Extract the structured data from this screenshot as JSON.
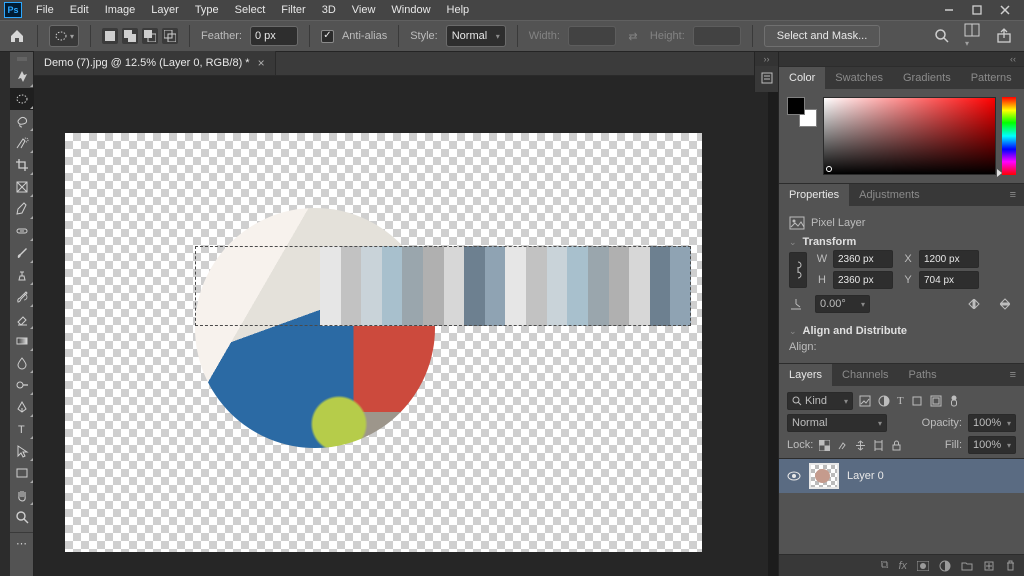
{
  "window_controls": {
    "minimize": "–",
    "maximize": "❐",
    "close": "✕"
  },
  "menu": [
    "File",
    "Edit",
    "Image",
    "Layer",
    "Type",
    "Select",
    "Filter",
    "3D",
    "View",
    "Window",
    "Help"
  ],
  "options": {
    "feather_label": "Feather:",
    "feather_value": "0 px",
    "antialias_label": "Anti-alias",
    "style_label": "Style:",
    "style_value": "Normal",
    "width_label": "Width:",
    "height_label": "Height:",
    "select_mask": "Select and Mask..."
  },
  "doc_tab": "Demo (7).jpg @ 12.5% (Layer 0, RGB/8) *",
  "tools": [
    "move-tool",
    "elliptical-marquee-tool",
    "lasso-tool",
    "quick-selection-tool",
    "crop-tool",
    "frame-tool",
    "eyedropper-tool",
    "healing-brush-tool",
    "brush-tool",
    "clone-stamp-tool",
    "history-brush-tool",
    "eraser-tool",
    "gradient-tool",
    "blur-tool",
    "dodge-tool",
    "pen-tool",
    "type-tool",
    "path-selection-tool",
    "rectangle-tool",
    "hand-tool",
    "zoom-tool"
  ],
  "color": {
    "tabs": [
      "Color",
      "Swatches",
      "Gradients",
      "Patterns"
    ]
  },
  "properties": {
    "tabs": [
      "Properties",
      "Adjustments"
    ],
    "type": "Pixel Layer",
    "transform_label": "Transform",
    "w_label": "W",
    "w_value": "2360 px",
    "h_label": "H",
    "h_value": "2360 px",
    "x_label": "X",
    "x_value": "1200 px",
    "y_label": "Y",
    "y_value": "704 px",
    "angle_value": "0.00°",
    "align_label": "Align and Distribute",
    "align_sub": "Align:"
  },
  "layers": {
    "tabs": [
      "Layers",
      "Channels",
      "Paths"
    ],
    "kind_label": "Kind",
    "blend_mode": "Normal",
    "opacity_label": "Opacity:",
    "opacity_value": "100%",
    "lock_label": "Lock:",
    "fill_label": "Fill:",
    "fill_value": "100%",
    "layer0": "Layer 0"
  }
}
